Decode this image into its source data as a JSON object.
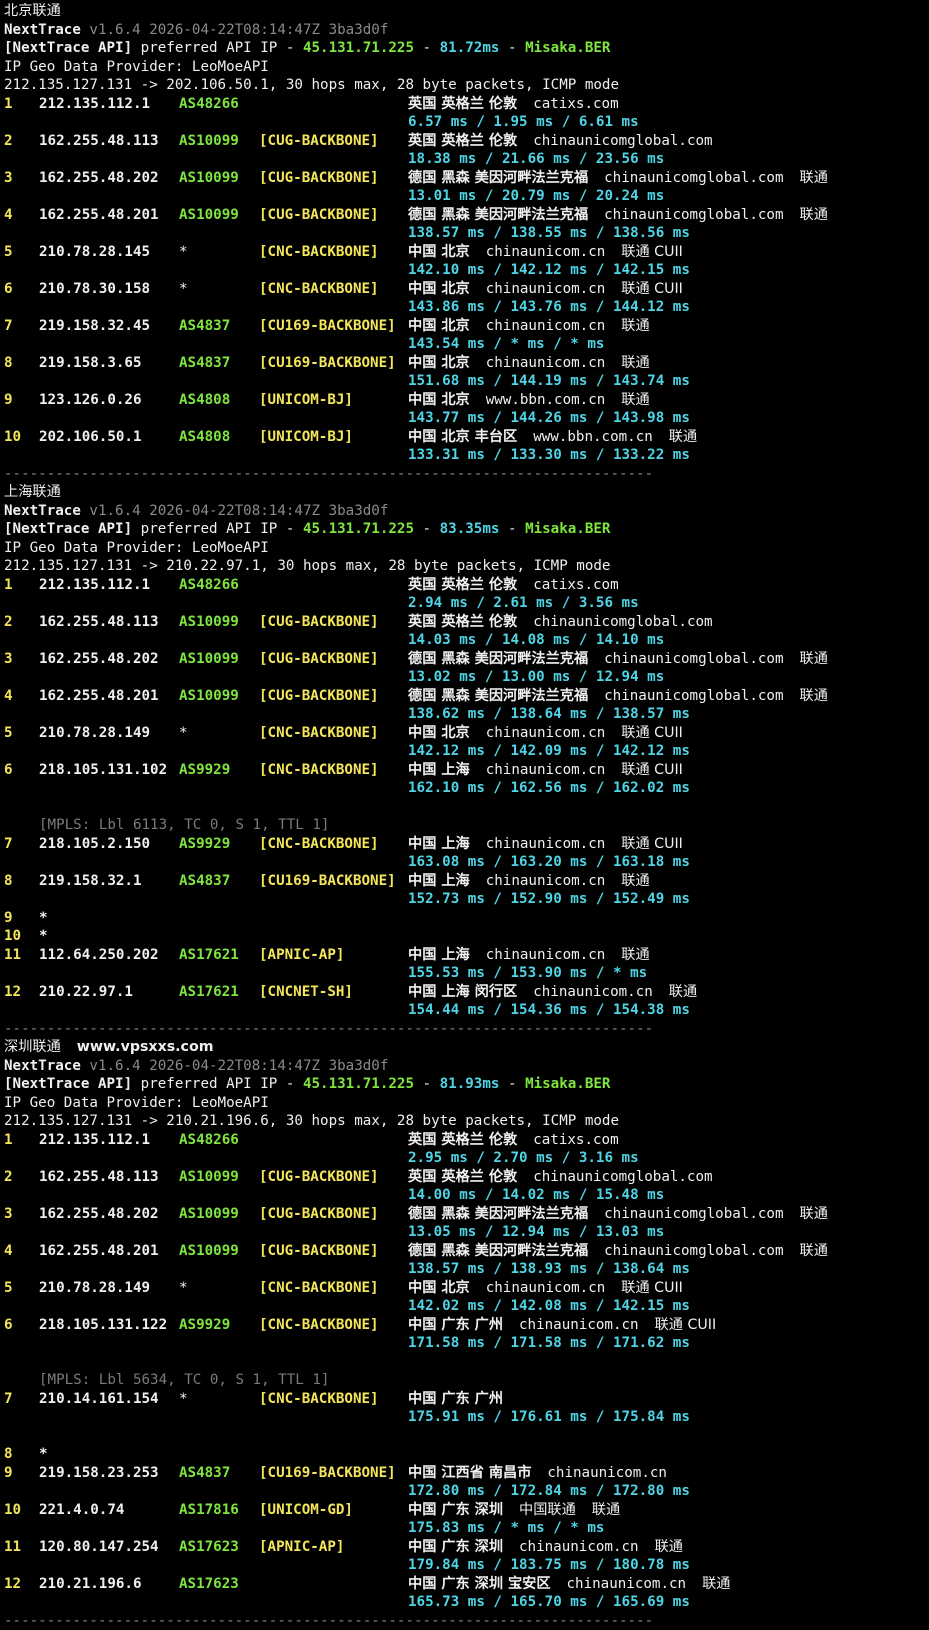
{
  "sections": [
    {
      "title": "北京联通",
      "title_extra": "",
      "header": {
        "name": "NextTrace",
        "version": "v1.6.4 2026-04-22T08:14:47Z 3ba3d0f",
        "api_tag": "[NextTrace API]",
        "api_text": "preferred API IP -",
        "api_ip": "45.131.71.225",
        "dash1": "-",
        "api_latency": "81.72ms",
        "dash2": "-",
        "api_node": "Misaka.BER",
        "geo_provider": "IP Geo Data Provider: LeoMoeAPI",
        "trace_line": "212.135.127.131 -> 202.106.50.1, 30 hops max, 28 byte packets, ICMP mode"
      },
      "hops": [
        {
          "n": "1",
          "ip": "212.135.112.1",
          "asn": "AS48266",
          "tag": "",
          "geo": "英国 英格兰 伦敦",
          "host": "catixs.com",
          "isp": "",
          "rtt": "6.57 ms / 1.95 ms / 6.61 ms"
        },
        {
          "n": "2",
          "ip": "162.255.48.113",
          "asn": "AS10099",
          "tag": "[CUG-BACKBONE]",
          "geo": "英国 英格兰 伦敦",
          "host": "chinaunicomglobal.com",
          "isp": "",
          "rtt": "18.38 ms / 21.66 ms / 23.56 ms"
        },
        {
          "n": "3",
          "ip": "162.255.48.202",
          "asn": "AS10099",
          "tag": "[CUG-BACKBONE]",
          "geo": "德国 黑森 美因河畔法兰克福",
          "host": "chinaunicomglobal.com",
          "isp": "联通",
          "rtt": "13.01 ms / 20.79 ms / 20.24 ms"
        },
        {
          "n": "4",
          "ip": "162.255.48.201",
          "asn": "AS10099",
          "tag": "[CUG-BACKBONE]",
          "geo": "德国 黑森 美因河畔法兰克福",
          "host": "chinaunicomglobal.com",
          "isp": "联通",
          "rtt": "138.57 ms / 138.55 ms / 138.56 ms"
        },
        {
          "n": "5",
          "ip": "210.78.28.145",
          "asn": "*",
          "tag": "[CNC-BACKBONE]",
          "geo": "中国 北京",
          "host": "chinaunicom.cn",
          "isp": "联通 CUII",
          "rtt": "142.10 ms / 142.12 ms / 142.15 ms"
        },
        {
          "n": "6",
          "ip": "210.78.30.158",
          "asn": "*",
          "tag": "[CNC-BACKBONE]",
          "geo": "中国 北京",
          "host": "chinaunicom.cn",
          "isp": "联通 CUII",
          "rtt": "143.86 ms / 143.76 ms / 144.12 ms"
        },
        {
          "n": "7",
          "ip": "219.158.32.45",
          "asn": "AS4837",
          "tag": "[CU169-BACKBONE]",
          "geo": "中国 北京",
          "host": "chinaunicom.cn",
          "isp": "联通",
          "rtt": "143.54 ms / * ms / * ms"
        },
        {
          "n": "8",
          "ip": "219.158.3.65",
          "asn": "AS4837",
          "tag": "[CU169-BACKBONE]",
          "geo": "中国 北京",
          "host": "chinaunicom.cn",
          "isp": "联通",
          "rtt": "151.68 ms / 144.19 ms / 143.74 ms"
        },
        {
          "n": "9",
          "ip": "123.126.0.26",
          "asn": "AS4808",
          "tag": "[UNICOM-BJ]",
          "geo": "中国 北京",
          "host": "www.bbn.com.cn",
          "isp": "联通",
          "rtt": "143.77 ms / 144.26 ms / 143.98 ms"
        },
        {
          "n": "10",
          "ip": "202.106.50.1",
          "asn": "AS4808",
          "tag": "[UNICOM-BJ]",
          "geo": "中国 北京 丰台区",
          "host": "www.bbn.com.cn",
          "isp": "联通",
          "rtt": "133.31 ms / 133.30 ms / 133.22 ms"
        }
      ]
    },
    {
      "title": "上海联通",
      "title_extra": "",
      "header": {
        "name": "NextTrace",
        "version": "v1.6.4 2026-04-22T08:14:47Z 3ba3d0f",
        "api_tag": "[NextTrace API]",
        "api_text": "preferred API IP -",
        "api_ip": "45.131.71.225",
        "dash1": "-",
        "api_latency": "83.35ms",
        "dash2": "-",
        "api_node": "Misaka.BER",
        "geo_provider": "IP Geo Data Provider: LeoMoeAPI",
        "trace_line": "212.135.127.131 -> 210.22.97.1, 30 hops max, 28 byte packets, ICMP mode"
      },
      "hops": [
        {
          "n": "1",
          "ip": "212.135.112.1",
          "asn": "AS48266",
          "tag": "",
          "geo": "英国 英格兰 伦敦",
          "host": "catixs.com",
          "isp": "",
          "rtt": "2.94 ms / 2.61 ms / 3.56 ms"
        },
        {
          "n": "2",
          "ip": "162.255.48.113",
          "asn": "AS10099",
          "tag": "[CUG-BACKBONE]",
          "geo": "英国 英格兰 伦敦",
          "host": "chinaunicomglobal.com",
          "isp": "",
          "rtt": "14.03 ms / 14.08 ms / 14.10 ms"
        },
        {
          "n": "3",
          "ip": "162.255.48.202",
          "asn": "AS10099",
          "tag": "[CUG-BACKBONE]",
          "geo": "德国 黑森 美因河畔法兰克福",
          "host": "chinaunicomglobal.com",
          "isp": "联通",
          "rtt": "13.02 ms / 13.00 ms / 12.94 ms"
        },
        {
          "n": "4",
          "ip": "162.255.48.201",
          "asn": "AS10099",
          "tag": "[CUG-BACKBONE]",
          "geo": "德国 黑森 美因河畔法兰克福",
          "host": "chinaunicomglobal.com",
          "isp": "联通",
          "rtt": "138.62 ms / 138.64 ms / 138.57 ms"
        },
        {
          "n": "5",
          "ip": "210.78.28.149",
          "asn": "*",
          "tag": "[CNC-BACKBONE]",
          "geo": "中国 北京",
          "host": "chinaunicom.cn",
          "isp": "联通 CUII",
          "rtt": "142.12 ms / 142.09 ms / 142.12 ms"
        },
        {
          "n": "6",
          "ip": "218.105.131.102",
          "asn": "AS9929",
          "tag": "[CNC-BACKBONE]",
          "geo": "中国 上海",
          "host": "chinaunicom.cn",
          "isp": "联通 CUII",
          "rtt": "162.10 ms / 162.56 ms / 162.02 ms",
          "mpls": "[MPLS: Lbl 6113, TC 0, S 1, TTL 1]"
        },
        {
          "n": "7",
          "ip": "218.105.2.150",
          "asn": "AS9929",
          "tag": "[CNC-BACKBONE]",
          "geo": "中国 上海",
          "host": "chinaunicom.cn",
          "isp": "联通 CUII",
          "rtt": "163.08 ms / 163.20 ms / 163.18 ms"
        },
        {
          "n": "8",
          "ip": "219.158.32.1",
          "asn": "AS4837",
          "tag": "[CU169-BACKBONE]",
          "geo": "中国 上海",
          "host": "chinaunicom.cn",
          "isp": "联通",
          "rtt": "152.73 ms / 152.90 ms / 152.49 ms"
        },
        {
          "n": "9",
          "star": true
        },
        {
          "n": "10",
          "star": true
        },
        {
          "n": "11",
          "ip": "112.64.250.202",
          "asn": "AS17621",
          "tag": "[APNIC-AP]",
          "geo": "中国 上海",
          "host": "chinaunicom.cn",
          "isp": "联通",
          "rtt": "155.53 ms / 153.90 ms / * ms"
        },
        {
          "n": "12",
          "ip": "210.22.97.1",
          "asn": "AS17621",
          "tag": "[CNCNET-SH]",
          "geo": "中国 上海 闵行区",
          "host": "chinaunicom.cn",
          "isp": "联通",
          "rtt": "154.44 ms / 154.36 ms / 154.38 ms"
        }
      ]
    },
    {
      "title": "深圳联通",
      "title_extra": "www.vpsxxs.com",
      "header": {
        "name": "NextTrace",
        "version": "v1.6.4 2026-04-22T08:14:47Z 3ba3d0f",
        "api_tag": "[NextTrace API]",
        "api_text": "preferred API IP -",
        "api_ip": "45.131.71.225",
        "dash1": "-",
        "api_latency": "81.93ms",
        "dash2": "-",
        "api_node": "Misaka.BER",
        "geo_provider": "IP Geo Data Provider: LeoMoeAPI",
        "trace_line": "212.135.127.131 -> 210.21.196.6, 30 hops max, 28 byte packets, ICMP mode"
      },
      "hops": [
        {
          "n": "1",
          "ip": "212.135.112.1",
          "asn": "AS48266",
          "tag": "",
          "geo": "英国 英格兰 伦敦",
          "host": "catixs.com",
          "isp": "",
          "rtt": "2.95 ms / 2.70 ms / 3.16 ms"
        },
        {
          "n": "2",
          "ip": "162.255.48.113",
          "asn": "AS10099",
          "tag": "[CUG-BACKBONE]",
          "geo": "英国 英格兰 伦敦",
          "host": "chinaunicomglobal.com",
          "isp": "",
          "rtt": "14.00 ms / 14.02 ms / 15.48 ms"
        },
        {
          "n": "3",
          "ip": "162.255.48.202",
          "asn": "AS10099",
          "tag": "[CUG-BACKBONE]",
          "geo": "德国 黑森 美因河畔法兰克福",
          "host": "chinaunicomglobal.com",
          "isp": "联通",
          "rtt": "13.05 ms / 12.94 ms / 13.03 ms"
        },
        {
          "n": "4",
          "ip": "162.255.48.201",
          "asn": "AS10099",
          "tag": "[CUG-BACKBONE]",
          "geo": "德国 黑森 美因河畔法兰克福",
          "host": "chinaunicomglobal.com",
          "isp": "联通",
          "rtt": "138.57 ms / 138.93 ms / 138.64 ms"
        },
        {
          "n": "5",
          "ip": "210.78.28.149",
          "asn": "*",
          "tag": "[CNC-BACKBONE]",
          "geo": "中国 北京",
          "host": "chinaunicom.cn",
          "isp": "联通 CUII",
          "rtt": "142.02 ms / 142.08 ms / 142.15 ms"
        },
        {
          "n": "6",
          "ip": "218.105.131.122",
          "asn": "AS9929",
          "tag": "[CNC-BACKBONE]",
          "geo": "中国 广东 广州",
          "host": "chinaunicom.cn",
          "isp": "联通 CUII",
          "rtt": "171.58 ms / 171.58 ms / 171.62 ms",
          "mpls": "[MPLS: Lbl 5634, TC 0, S 1, TTL 1]"
        },
        {
          "n": "7",
          "ip": "210.14.161.154",
          "asn": "*",
          "tag": "[CNC-BACKBONE]",
          "geo": "中国 广东 广州",
          "host": "",
          "isp": "",
          "rtt": "175.91 ms / 176.61 ms / 175.84 ms",
          "gap_after": true
        },
        {
          "n": "8",
          "star": true
        },
        {
          "n": "9",
          "ip": "219.158.23.253",
          "asn": "AS4837",
          "tag": "[CU169-BACKBONE]",
          "geo": "中国 江西省 南昌市",
          "host": "chinaunicom.cn",
          "isp": "",
          "rtt": "172.80 ms / 172.84 ms / 172.80 ms"
        },
        {
          "n": "10",
          "ip": "221.4.0.74",
          "asn": "AS17816",
          "tag": "[UNICOM-GD]",
          "geo": "中国 广东 深圳",
          "host": "中国联通",
          "isp": "联通",
          "rtt": "175.83 ms / * ms / * ms"
        },
        {
          "n": "11",
          "ip": "120.80.147.254",
          "asn": "AS17623",
          "tag": "[APNIC-AP]",
          "geo": "中国 广东 深圳",
          "host": "chinaunicom.cn",
          "isp": "联通",
          "rtt": "179.84 ms / 183.75 ms / 180.78 ms"
        },
        {
          "n": "12",
          "ip": "210.21.196.6",
          "asn": "AS17623",
          "tag": "",
          "geo": "中国 广东 深圳 宝安区",
          "host": "chinaunicom.cn",
          "isp": "联通",
          "rtt": "165.73 ms / 165.70 ms / 165.69 ms"
        }
      ]
    }
  ],
  "separator": "----------------------------------------------------------------------------",
  "colors": {
    "background": "#000000",
    "hop_number": "#f4e65a",
    "asn": "#7fe53f",
    "backbone_tag": "#f4e65a",
    "rtt": "#4fd5e6",
    "api_ip": "#7fe53f",
    "api_latency": "#4fd5e6",
    "version": "#8a8a8a"
  }
}
